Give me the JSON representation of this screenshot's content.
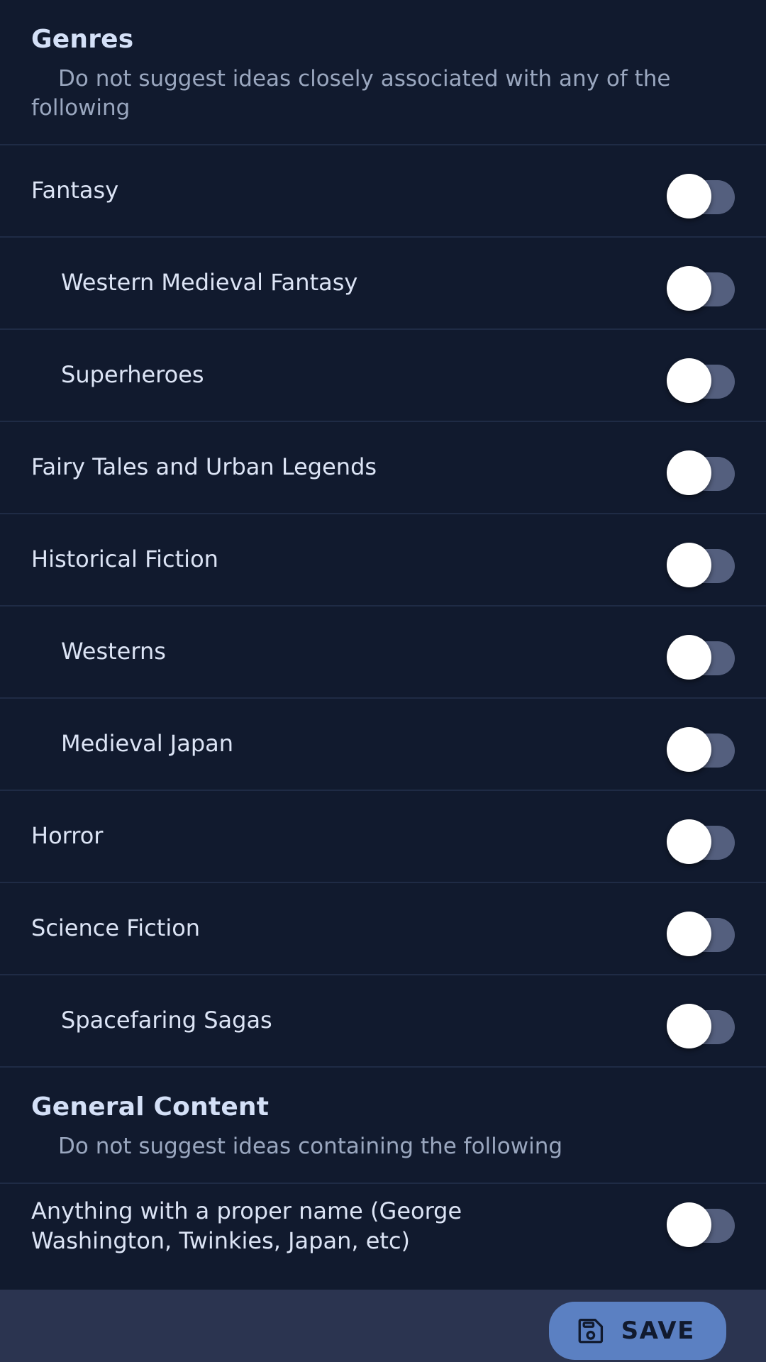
{
  "theme": {
    "background": "#111a2e",
    "divider": "#1f2b45",
    "section_title_color": "#d4e0f7",
    "subtitle_color": "#9aa7bf",
    "label_color": "#dce4f5",
    "toggle_track_color": "#545f7e",
    "toggle_thumb_color": "#ffffff",
    "bottom_bar_color": "#2b3450",
    "save_button_color": "#5b80c2",
    "save_text_color": "#111a2e"
  },
  "sections": [
    {
      "id": "genres",
      "title": "Genres",
      "subtitle": "Do not suggest ideas closely associated with any of the following",
      "rows": [
        {
          "label": "Fantasy",
          "indent": false,
          "enabled": false
        },
        {
          "label": "Western Medieval Fantasy",
          "indent": true,
          "enabled": false
        },
        {
          "label": "Superheroes",
          "indent": true,
          "enabled": false
        },
        {
          "label": "Fairy Tales and Urban Legends",
          "indent": false,
          "enabled": false
        },
        {
          "label": "Historical Fiction",
          "indent": false,
          "enabled": false
        },
        {
          "label": "Westerns",
          "indent": true,
          "enabled": false
        },
        {
          "label": "Medieval Japan",
          "indent": true,
          "enabled": false
        },
        {
          "label": "Horror",
          "indent": false,
          "enabled": false
        },
        {
          "label": "Science Fiction",
          "indent": false,
          "enabled": false
        },
        {
          "label": "Spacefaring Sagas",
          "indent": true,
          "enabled": false
        }
      ]
    },
    {
      "id": "general-content",
      "title": "General Content",
      "subtitle": "Do not suggest ideas containing the following",
      "rows": [
        {
          "label": "Anything with a proper name (George Washington, Twinkies, Japan, etc)",
          "indent": false,
          "enabled": false,
          "clipped": true
        }
      ]
    }
  ],
  "bottom_bar": {
    "save_label": "SAVE",
    "save_icon": "floppy-disk-save-icon"
  }
}
